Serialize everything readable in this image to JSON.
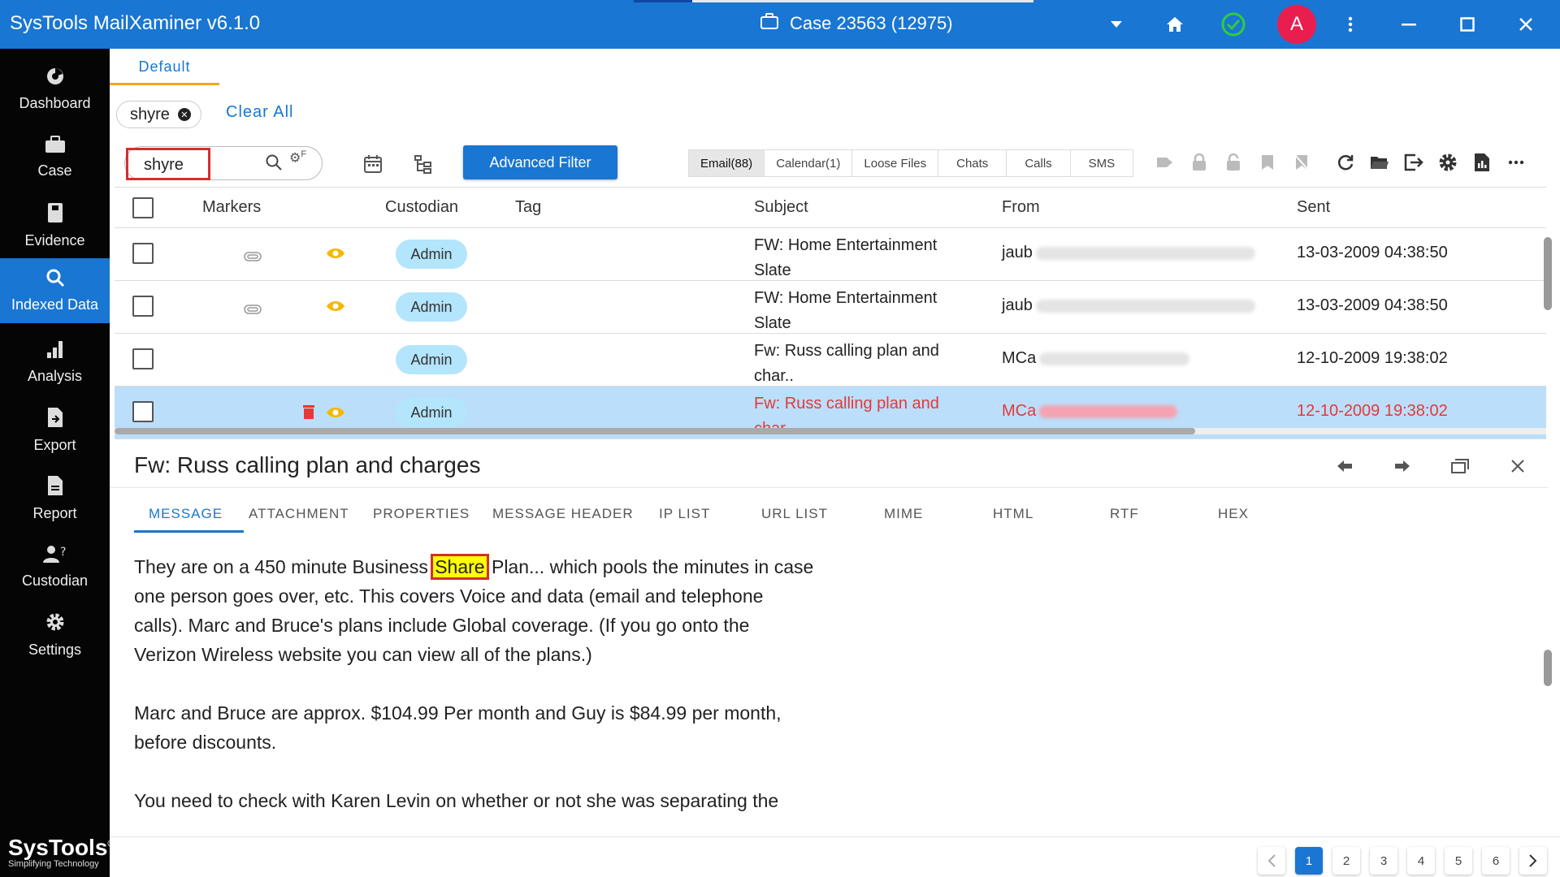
{
  "window": {
    "title": "SysTools MailXaminer v6.1.0",
    "case_label": "Case 23563 (12975)",
    "avatar_letter": "A",
    "accent": "#1976d2",
    "status_color": "#2ecc40",
    "avatar_color": "#e91e4e"
  },
  "sidebar": {
    "items": [
      {
        "label": "Dashboard",
        "icon": "dashboard-icon"
      },
      {
        "label": "Case",
        "icon": "briefcase-icon"
      },
      {
        "label": "Evidence",
        "icon": "evidence-icon"
      },
      {
        "label": "Indexed Data",
        "icon": "search-icon",
        "active": true
      },
      {
        "label": "Analysis",
        "icon": "bar-chart-icon"
      },
      {
        "label": "Export",
        "icon": "export-file-icon"
      },
      {
        "label": "Report",
        "icon": "report-file-icon"
      },
      {
        "label": "Custodian",
        "icon": "custodian-icon"
      },
      {
        "label": "Settings",
        "icon": "gear-icon"
      }
    ],
    "brand_name": "SysTools",
    "brand_tagline": "Simplifying Technology",
    "brand_mark": "®"
  },
  "tabs": {
    "default_label": "Default"
  },
  "filter": {
    "chip_label": "shyre",
    "clear_all": "Clear All",
    "search_value": "shyre",
    "gear_suffix": "F",
    "advanced_filter": "Advanced Filter"
  },
  "segments": [
    {
      "label": "Email(88)",
      "active": true
    },
    {
      "label": "Calendar(1)"
    },
    {
      "label": "Loose Files"
    },
    {
      "label": "Chats"
    },
    {
      "label": "Calls"
    },
    {
      "label": "SMS"
    }
  ],
  "table": {
    "headers": {
      "markers": "Markers",
      "custodian": "Custodian",
      "tag": "Tag",
      "subject": "Subject",
      "from": "From",
      "sent": "Sent"
    },
    "rows": [
      {
        "subject": "FW: Home Entertainment Slate",
        "from": "jaub",
        "sent": "13-03-2009 04:38:50",
        "custodian": "Admin"
      },
      {
        "subject": "FW: Home Entertainment Slate",
        "from": "jaub",
        "sent": "13-03-2009 04:38:50",
        "custodian": "Admin"
      },
      {
        "subject": "Fw: Russ calling plan and char..",
        "from": "MCa",
        "sent": "12-10-2009 19:38:02",
        "custodian": "Admin"
      },
      {
        "subject": "Fw: Russ calling plan and char..",
        "from": "MCa",
        "sent": "12-10-2009 19:38:02",
        "custodian": "Admin",
        "selected": true
      }
    ]
  },
  "preview": {
    "title": "Fw: Russ calling plan and charges",
    "tabs": [
      "MESSAGE",
      "ATTACHMENT",
      "PROPERTIES",
      "MESSAGE HEADER",
      "IP LIST",
      "URL LIST",
      "MIME",
      "HTML",
      "RTF",
      "HEX"
    ],
    "para1_before": "They are on a 450 minute Business ",
    "para1_highlight": "Share",
    "para1_after": " Plan... which pools the minutes in case one person goes over, etc.  This covers Voice and data  (email and telephone calls).  Marc and Bruce's plans include Global coverage.   (If you go onto the Verizon Wireless website you can view all of the plans.)",
    "para2": "Marc and Bruce are approx. $104.99 Per month and Guy is $84.99 per month, before discounts.",
    "para3": "You need to check with Karen Levin on whether or not she was separating the"
  },
  "pagination": {
    "pages": [
      "1",
      "2",
      "3",
      "4",
      "5",
      "6"
    ],
    "current": "1"
  }
}
